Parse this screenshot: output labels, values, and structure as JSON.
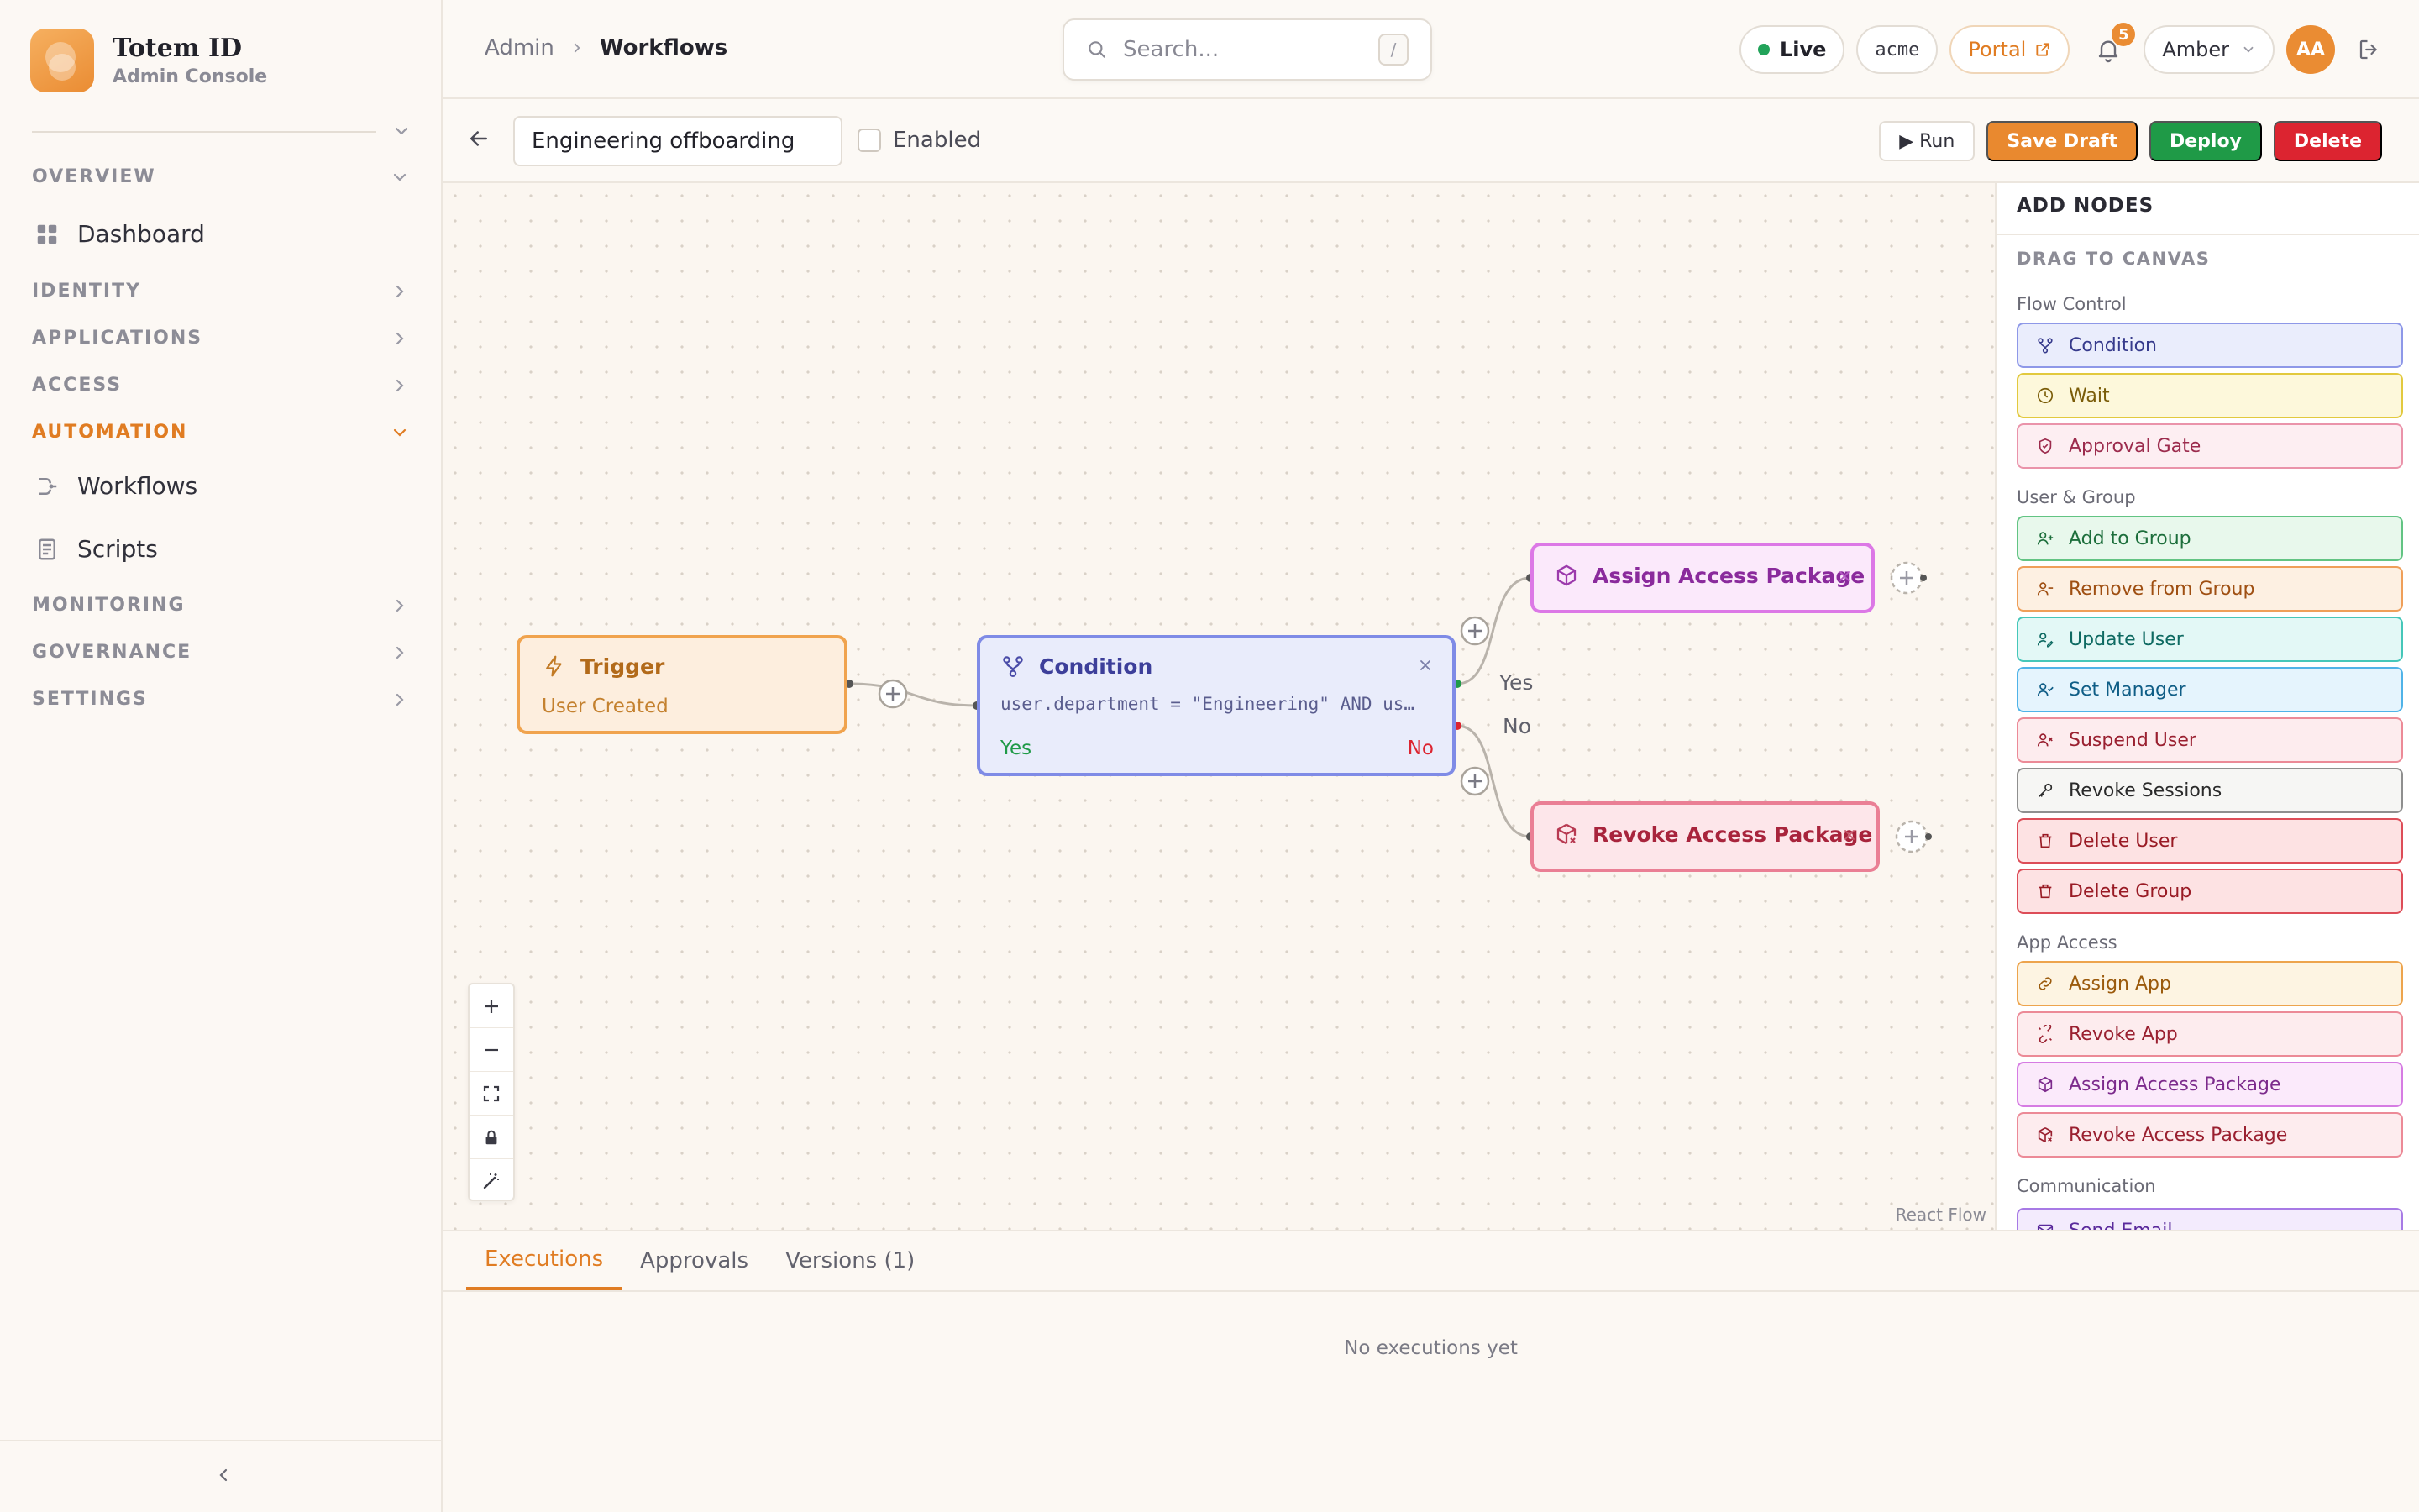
{
  "brand": {
    "name": "Totem ID",
    "subtitle": "Admin Console"
  },
  "sidebar": {
    "sections": [
      {
        "label": "OVERVIEW",
        "expanded": true
      },
      {
        "label": "IDENTITY",
        "expanded": false
      },
      {
        "label": "APPLICATIONS",
        "expanded": false
      },
      {
        "label": "ACCESS",
        "expanded": false
      },
      {
        "label": "AUTOMATION",
        "expanded": true,
        "active": true
      },
      {
        "label": "MONITORING",
        "expanded": false
      },
      {
        "label": "GOVERNANCE",
        "expanded": false
      },
      {
        "label": "SETTINGS",
        "expanded": false
      }
    ],
    "items": {
      "dashboard": "Dashboard",
      "workflows": "Workflows",
      "scripts": "Scripts"
    }
  },
  "header": {
    "breadcrumb": [
      "Admin",
      "Workflows"
    ],
    "search_placeholder": "Search...",
    "search_shortcut": "/",
    "env_label": "Live",
    "org_label": "acme",
    "portal_label": "Portal",
    "notification_count": "5",
    "user_name": "Amber",
    "avatar_initials": "AA"
  },
  "toolbar": {
    "workflow_name": "Engineering offboarding",
    "enabled_label": "Enabled",
    "enabled": false,
    "run_label": "▶ Run",
    "save_draft_label": "Save Draft",
    "deploy_label": "Deploy",
    "delete_label": "Delete"
  },
  "canvas": {
    "trigger": {
      "title": "Trigger",
      "subtitle": "User Created"
    },
    "condition": {
      "title": "Condition",
      "expression": "user.department = \"Engineering\" AND us…",
      "yes_label": "Yes",
      "no_label": "No"
    },
    "assign_node": {
      "title": "Assign Access Package"
    },
    "revoke_node": {
      "title": "Revoke Access Package"
    },
    "edge_labels": {
      "yes": "Yes",
      "no": "No"
    },
    "attribution": "React Flow"
  },
  "palette": {
    "title": "ADD NODES",
    "subtitle": "DRAG TO CANVAS",
    "groups": [
      {
        "label": "Flow Control",
        "items": [
          "Condition",
          "Wait",
          "Approval Gate"
        ]
      },
      {
        "label": "User & Group",
        "items": [
          "Add to Group",
          "Remove from Group",
          "Update User",
          "Set Manager",
          "Suspend User",
          "Revoke Sessions",
          "Delete User",
          "Delete Group"
        ]
      },
      {
        "label": "App Access",
        "items": [
          "Assign App",
          "Revoke App",
          "Assign Access Package",
          "Revoke Access Package"
        ]
      },
      {
        "label": "Communication",
        "items": [
          "Send Email"
        ]
      }
    ]
  },
  "bottom": {
    "tabs": [
      "Executions",
      "Approvals",
      "Versions (1)"
    ],
    "active_tab": "Executions",
    "empty_message": "No executions yet"
  }
}
